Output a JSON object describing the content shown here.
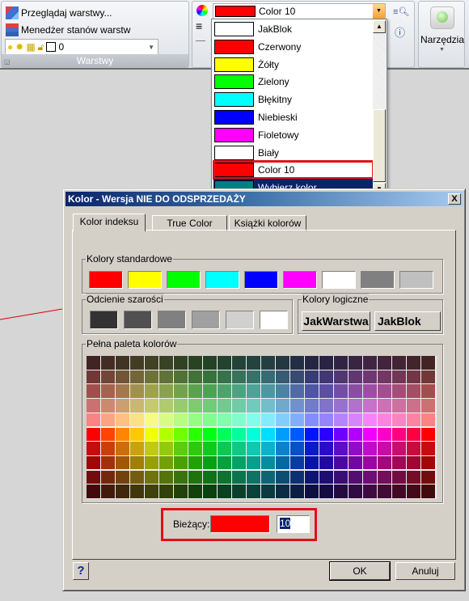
{
  "ribbon": {
    "layers": {
      "browse_label": "Przeglądaj warstwy...",
      "state_manager_label": "Menedżer stanów warstw",
      "layer_value": "0",
      "panel_label": "Warstwy"
    },
    "properties": {
      "color_value": "Color 10",
      "color_hex": "#ff0000"
    },
    "tools": {
      "label": "Narzędzia"
    }
  },
  "dropdown": {
    "items": [
      {
        "label": "JakBlok",
        "color": "#ffffff"
      },
      {
        "label": "Czerwony",
        "color": "#ff0000"
      },
      {
        "label": "Żółty",
        "color": "#ffff00"
      },
      {
        "label": "Zielony",
        "color": "#00ff00"
      },
      {
        "label": "Błękitny",
        "color": "#00ffff"
      },
      {
        "label": "Niebieski",
        "color": "#0000ff"
      },
      {
        "label": "Fioletowy",
        "color": "#ff00ff"
      },
      {
        "label": "Biały",
        "color": "#ffffff"
      },
      {
        "label": "Color 10",
        "color": "#ff0000"
      },
      {
        "label": "Wybierz kolor...",
        "color": "#008080"
      }
    ],
    "highlighted": "Color 10",
    "selected": "Wybierz kolor..."
  },
  "dialog": {
    "title": "Kolor - Wersja NIE DO ODSPRZEDAŻY",
    "close": "X",
    "tabs": [
      {
        "label": "Kolor indeksu",
        "active": true
      },
      {
        "label": "True Color"
      },
      {
        "label": "Książki kolorów"
      }
    ],
    "standard": {
      "label": "Kolory standardowe",
      "colors": [
        "#ff0000",
        "#ffff00",
        "#00ff00",
        "#00ffff",
        "#0000ff",
        "#ff00ff",
        "#ffffff",
        "#808080",
        "#c0c0c0"
      ]
    },
    "grays": {
      "label": "Odcienie szarości",
      "colors": [
        "#333333",
        "#505050",
        "#808080",
        "#a0a0a0",
        "#d0d0d0",
        "#ffffff"
      ]
    },
    "logical": {
      "label": "Kolory logiczne",
      "bylayer": "JakWarstwa",
      "byblock": "JakBlok"
    },
    "palette": {
      "label": "Pełna paleta kolorów",
      "columns": 24,
      "rows": 10
    },
    "current": {
      "label": "Bieżący:",
      "color": "#ff0000",
      "value": "10"
    },
    "help": "?",
    "ok": "OK",
    "cancel": "Anuluj"
  }
}
